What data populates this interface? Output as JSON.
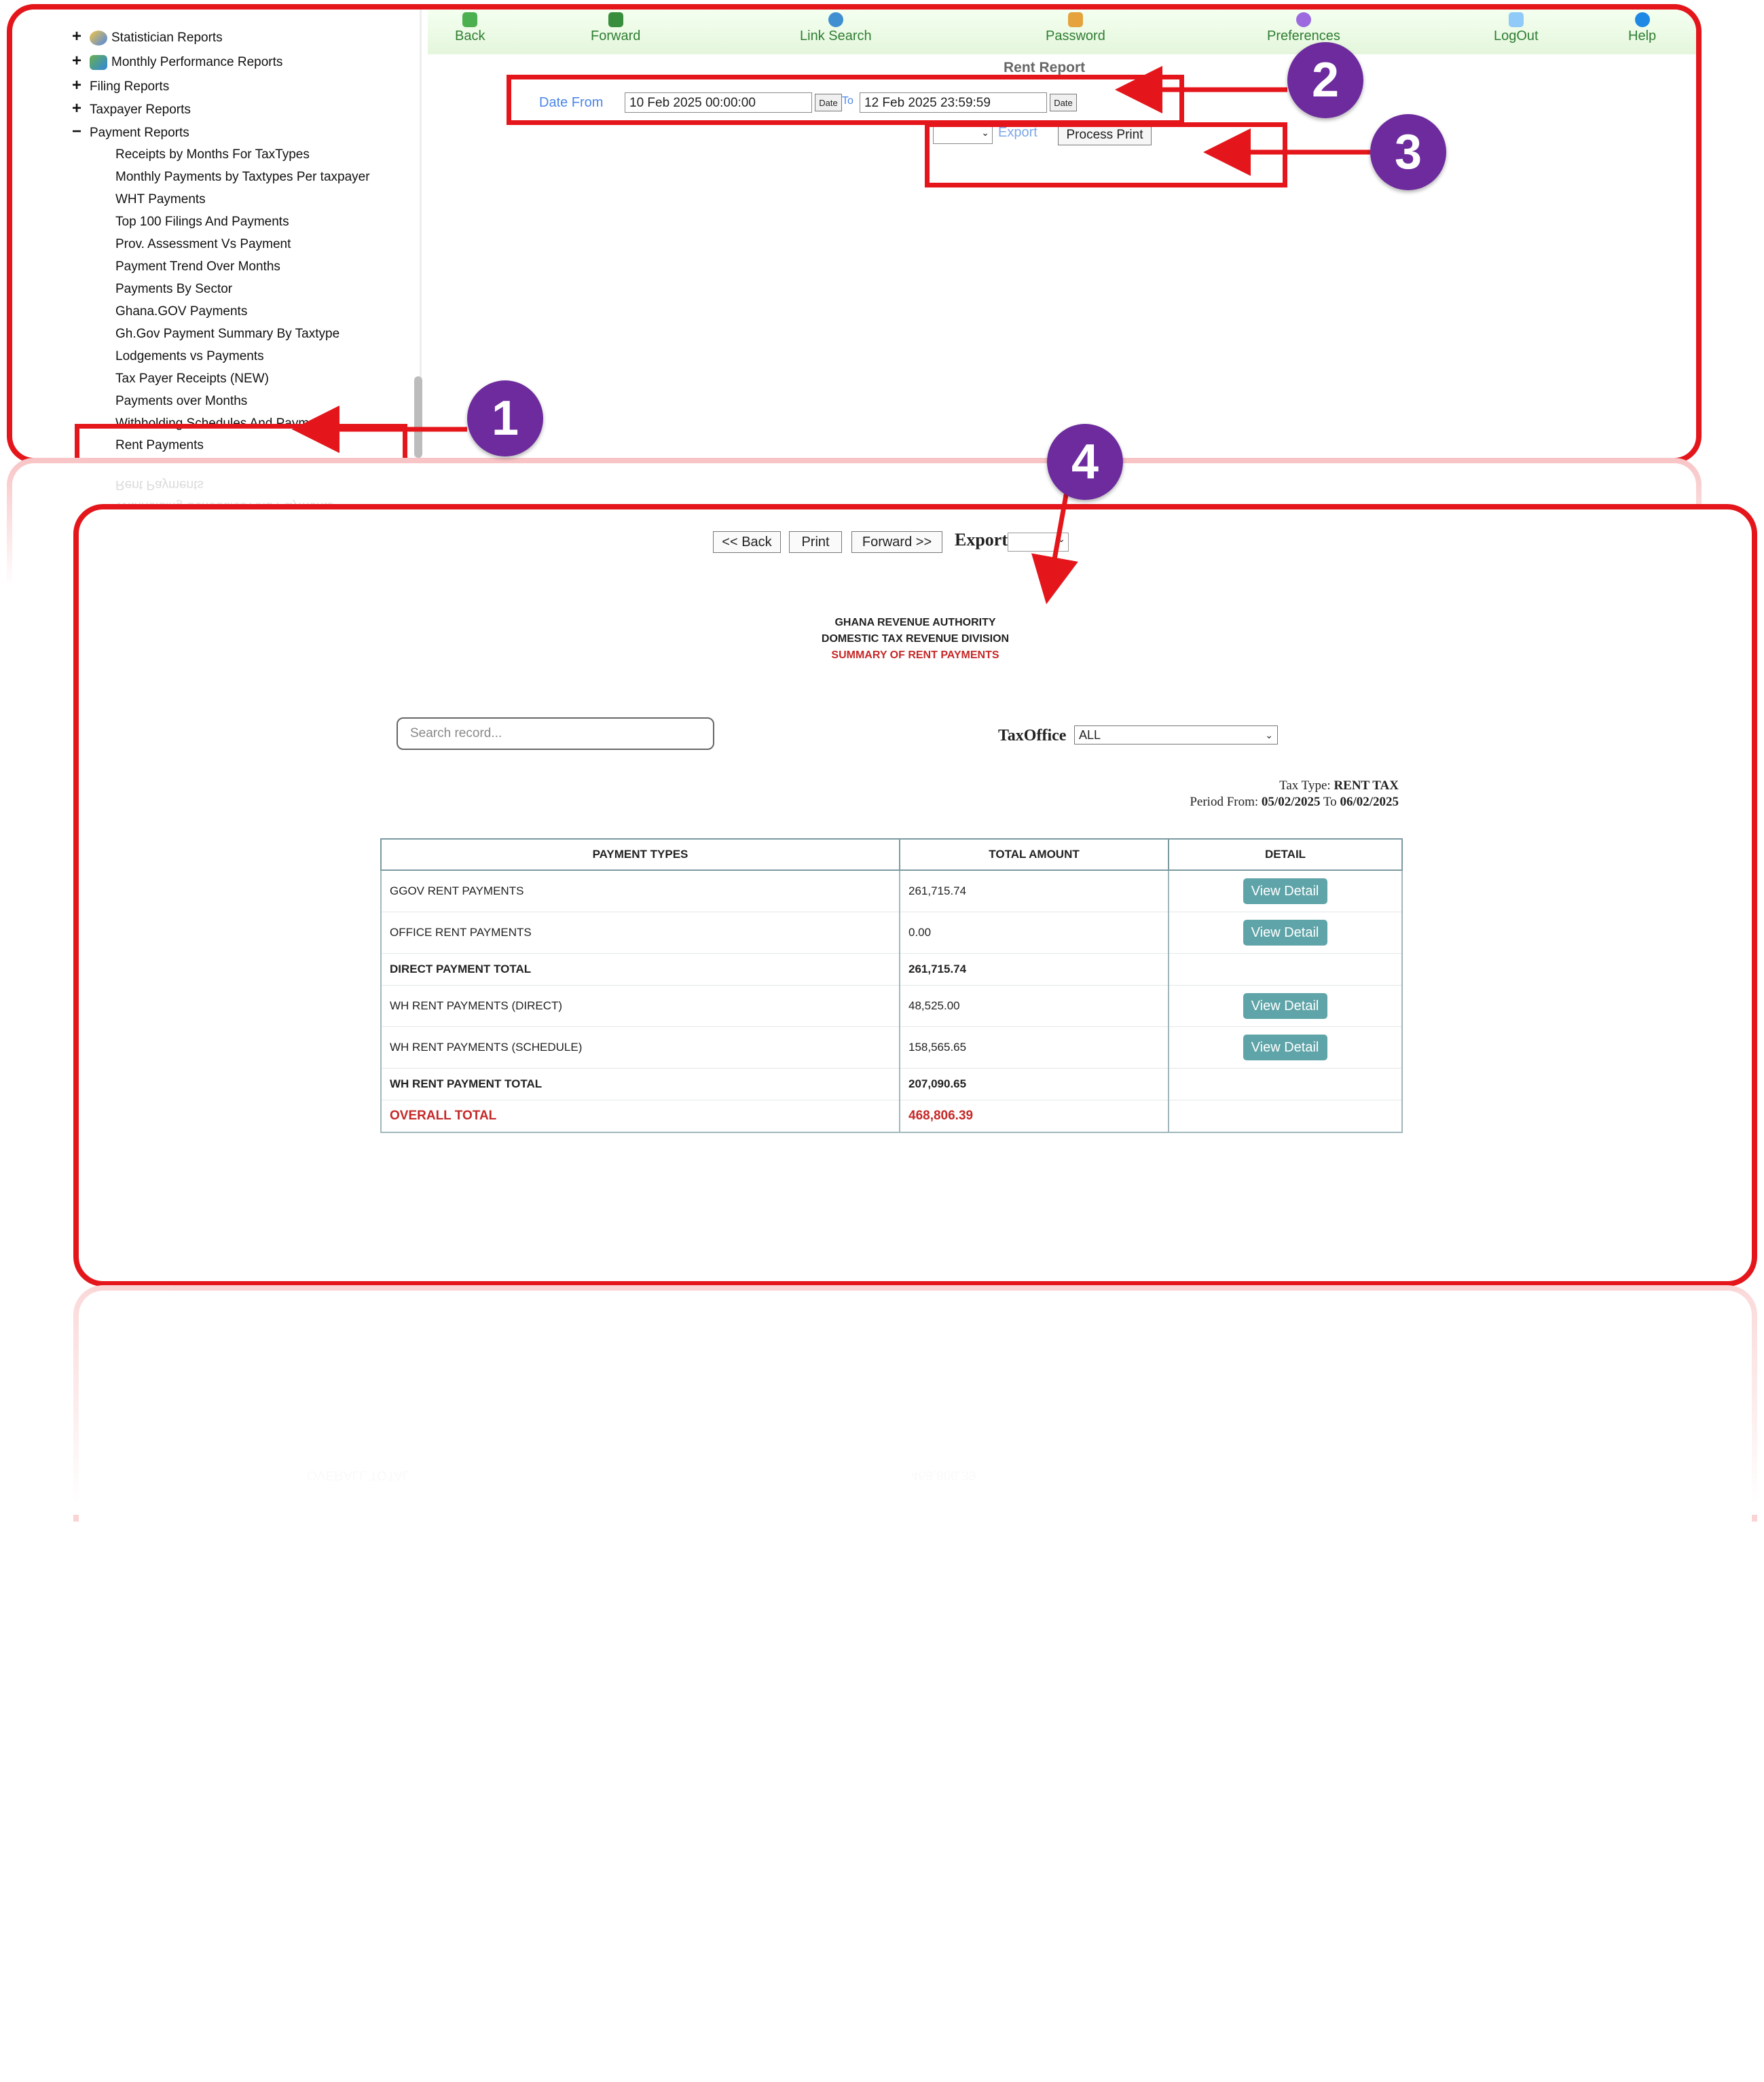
{
  "sidebar": {
    "items": [
      {
        "toggle": "+",
        "label": "Statistician Reports",
        "icon": "chart-icon"
      },
      {
        "toggle": "+",
        "label": "Monthly Performance Reports",
        "icon": "people-icon"
      },
      {
        "toggle": "+",
        "label": "Filing Reports"
      },
      {
        "toggle": "+",
        "label": "Taxpayer Reports"
      },
      {
        "toggle": "−",
        "label": "Payment Reports"
      }
    ],
    "payment_reports": [
      "Receipts by Months For TaxTypes",
      "Monthly Payments by Taxtypes Per taxpayer",
      "WHT Payments",
      "Top 100 Filings And Payments",
      "Prov. Assessment Vs Payment",
      "Payment Trend Over Months",
      "Payments By Sector",
      "Ghana.GOV Payments",
      "Gh.Gov Payment Summary By Taxtype",
      "Lodgements vs Payments",
      "Tax Payer Receipts (NEW)",
      "Payments over Months",
      "Withholding Schedules And Payments",
      "Rent Payments"
    ]
  },
  "toolbar": {
    "back": "Back",
    "forward": "Forward",
    "link_search": "Link Search",
    "password": "Password",
    "preferences": "Preferences",
    "logout": "LogOut",
    "help": "Help"
  },
  "report_form": {
    "title": "Rent Report",
    "date_from_label": "Date From",
    "date_from_value": "10 Feb 2025 00:00:00",
    "date_button": "Date",
    "to_label": "To",
    "date_to_value": "12 Feb 2025 23:59:59",
    "export_link": "Export",
    "process_print": "Process Print"
  },
  "report": {
    "back": "<< Back",
    "print": "Print",
    "forward": "Forward >>",
    "export_label": "Export",
    "org_line1": "GHANA REVENUE AUTHORITY",
    "org_line2": "DOMESTIC TAX REVENUE DIVISION",
    "subtitle": "SUMMARY OF RENT PAYMENTS",
    "search_placeholder": "Search record...",
    "taxoffice_label": "TaxOffice",
    "taxoffice_value": "ALL",
    "tax_type_label": "Tax Type:",
    "tax_type_value": "RENT TAX",
    "period_label": "Period From:",
    "period_from": "05/02/2025",
    "period_to_label": "To",
    "period_to": "06/02/2025",
    "columns": [
      "PAYMENT TYPES",
      "TOTAL AMOUNT",
      "DETAIL"
    ],
    "detail_button": "View Detail",
    "rows": [
      {
        "type": "GGOV RENT PAYMENTS",
        "amount": "261,715.74"
      },
      {
        "type": "OFFICE RENT PAYMENTS",
        "amount": "0.00"
      },
      {
        "type": "DIRECT PAYMENT TOTAL",
        "amount": "261,715.74"
      },
      {
        "type": "WH RENT PAYMENTS (DIRECT)",
        "amount": "48,525.00"
      },
      {
        "type": "WH RENT PAYMENTS (SCHEDULE)",
        "amount": "158,565.65"
      },
      {
        "type": "WH RENT PAYMENT TOTAL",
        "amount": "207,090.65"
      },
      {
        "type": "OVERALL TOTAL",
        "amount": "468,806.39"
      }
    ]
  },
  "callouts": [
    "1",
    "2",
    "3",
    "4"
  ],
  "colors": {
    "highlight": "#e4161b",
    "badge": "#6d2b9e",
    "button": "#5fa4a8",
    "total": "#c62828"
  }
}
